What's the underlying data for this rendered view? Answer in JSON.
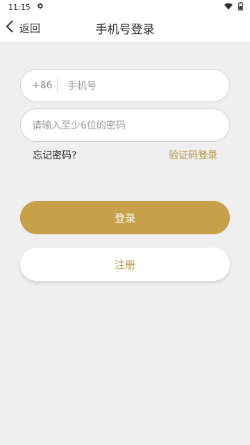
{
  "status_bar": {
    "time": "11:15",
    "icons": [
      "gear-icon",
      "wifi-icon",
      "battery-icon"
    ]
  },
  "header": {
    "back_label": "返回",
    "title": "手机号登录"
  },
  "form": {
    "country_code": "+86",
    "phone_placeholder": "手机号",
    "password_placeholder": "请输入至少6位的密码",
    "forgot_password": "忘记密码?",
    "code_login": "验证码登录",
    "login_button": "登录",
    "register_button": "注册"
  },
  "colors": {
    "accent": "#c7a04a",
    "accent_text": "#b8923d",
    "background": "#efefef"
  }
}
